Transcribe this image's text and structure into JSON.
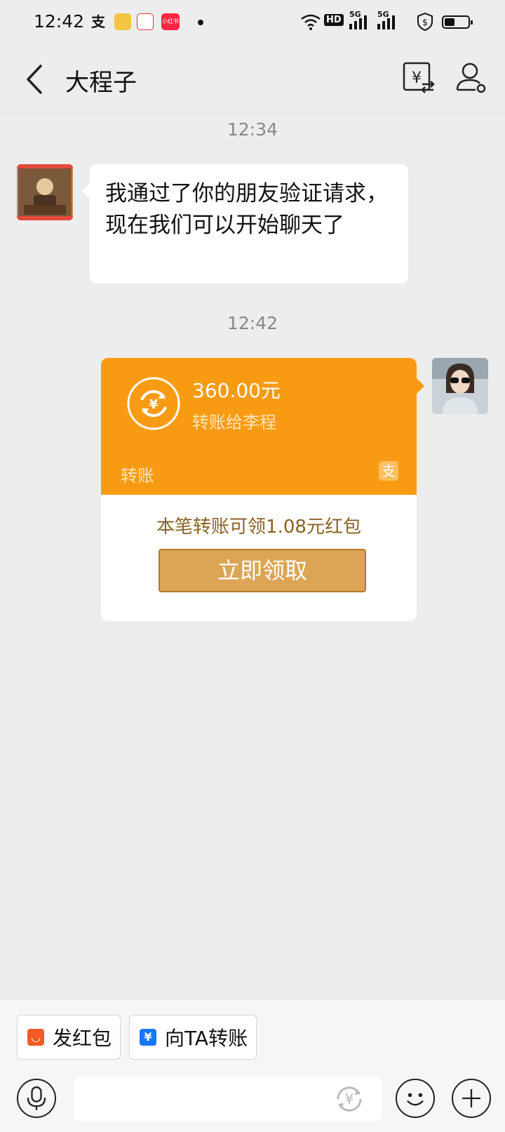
{
  "status_bar": {
    "time": "12:42",
    "apps": [
      {
        "name": "alipay-icon",
        "label": "支"
      },
      {
        "name": "books-icon",
        "label": ""
      },
      {
        "name": "weibo-icon",
        "label": ""
      },
      {
        "name": "xiaohongshu-icon",
        "label": "小红书"
      }
    ],
    "network_labels": [
      "HD",
      "5G",
      "5G"
    ],
    "battery_level": 0.45
  },
  "header": {
    "title": "大程子",
    "icons": [
      "back-arrow-icon",
      "transfer-icon",
      "profile-icon"
    ]
  },
  "messages": [
    {
      "timestamp": "12:34"
    },
    {
      "sender": "other",
      "text": "我通过了你的朋友验证请求，现在我们可以开始聊天了"
    },
    {
      "timestamp": "12:42"
    }
  ],
  "transfer": {
    "amount": "360.00元",
    "description": "转账给李程",
    "label": "转账",
    "logo": "支",
    "promo": "本笔转账可领1.08元红包",
    "button": "立即领取",
    "color": "#f99b12"
  },
  "quick_actions": [
    {
      "label": "发红包",
      "icon": "red-packet-icon",
      "color": "#f25a27"
    },
    {
      "label": "向TA转账",
      "icon": "transfer-yuan-icon",
      "color": "#1677ff"
    }
  ],
  "input_bar": {
    "icons": [
      "voice-icon",
      "yuan-icon",
      "emoji-icon",
      "plus-icon"
    ]
  }
}
